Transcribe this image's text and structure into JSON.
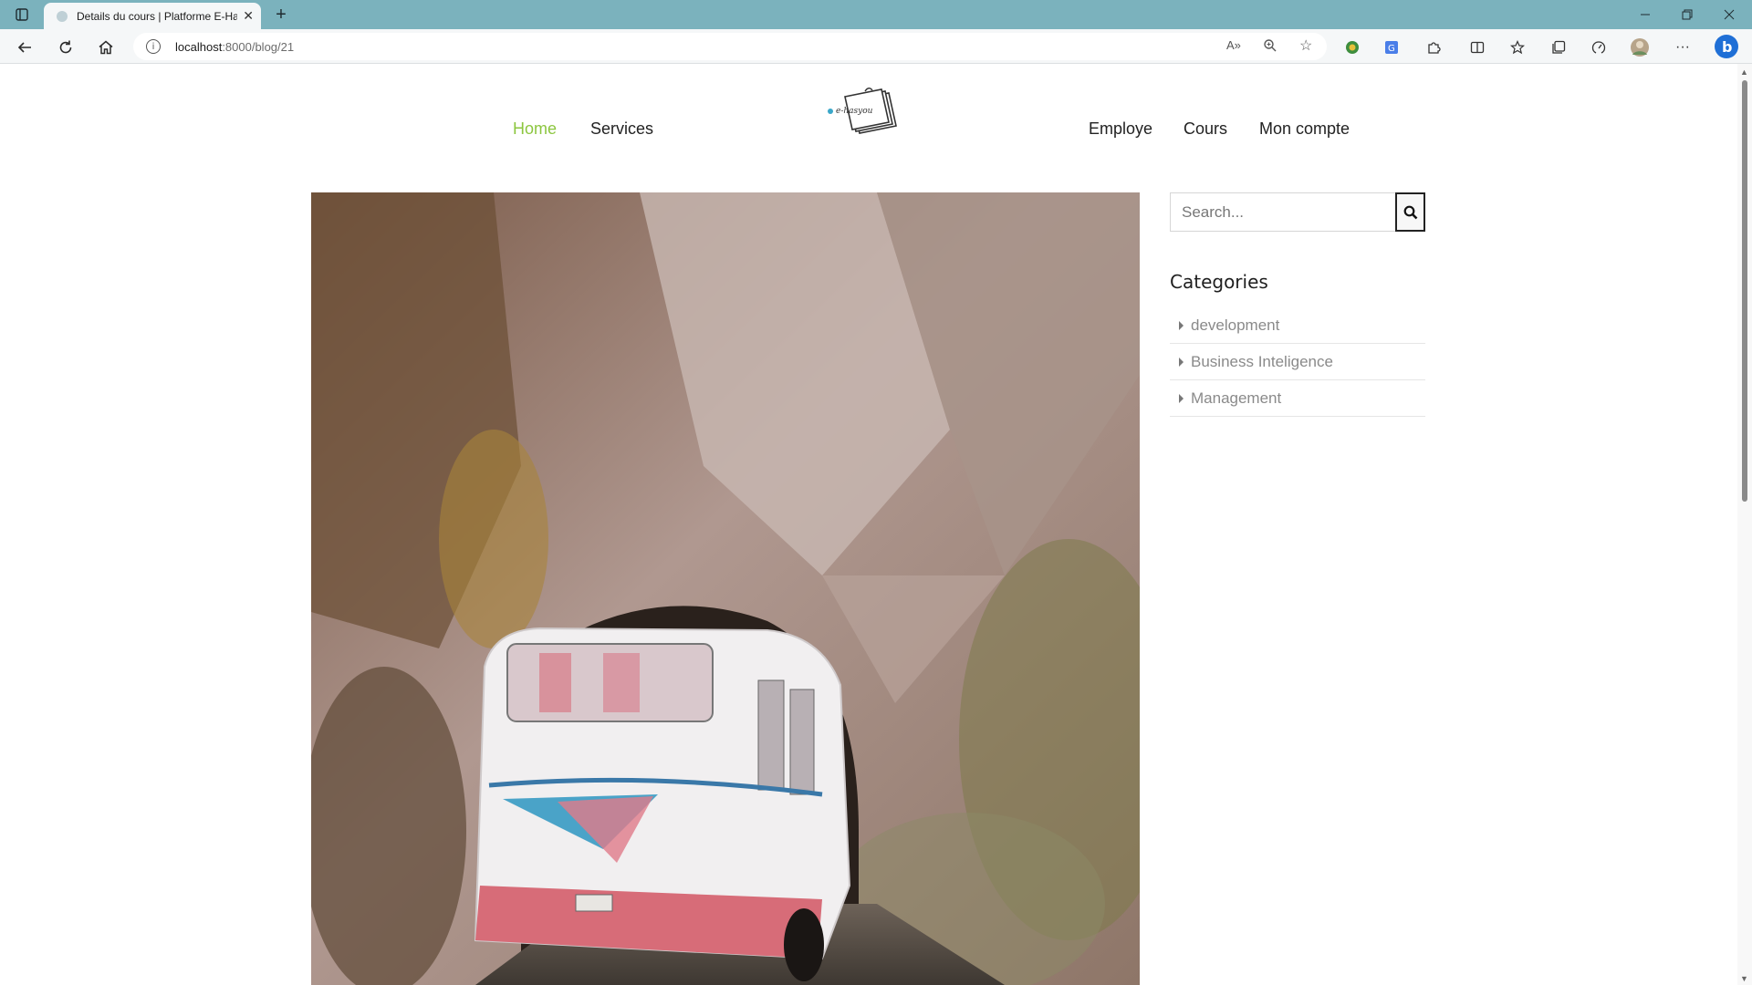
{
  "browser": {
    "tab_title": "Details du cours | Platforme E-Ha",
    "new_tab": "+",
    "url_host": "localhost",
    "url_path": ":8000/blog/21"
  },
  "site": {
    "nav_left": [
      "Home",
      "Services"
    ],
    "nav_right": [
      "Employe",
      "Cours",
      "Mon compte"
    ],
    "logo_text": "e-hasyou"
  },
  "sidebar": {
    "search_placeholder": "Search...",
    "categories_title": "Categories",
    "categories": [
      "development",
      "Business Inteligence",
      "Management"
    ]
  },
  "colors": {
    "active_nav": "#8cc63f",
    "tab_strip": "#7bb2bd"
  },
  "icons": [
    "tab-actions-icon",
    "back-icon",
    "refresh-icon",
    "home-icon",
    "info-icon",
    "read-aloud-icon",
    "zoom-icon",
    "favorite-star-icon",
    "extension-icon",
    "translate-icon",
    "puzzle-icon",
    "split-screen-icon",
    "favorites-icon",
    "collections-icon",
    "performance-icon",
    "profile-avatar-icon",
    "more-icon",
    "bing-icon",
    "search-icon"
  ]
}
